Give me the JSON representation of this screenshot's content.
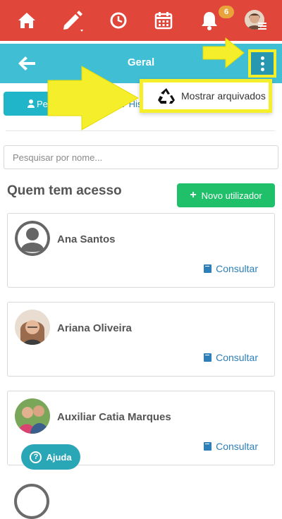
{
  "topbar": {
    "notification_count": "6",
    "icons": [
      "home-icon",
      "pencil-icon",
      "clock-icon",
      "calendar-icon",
      "bell-icon"
    ],
    "color": "#e0463a"
  },
  "subbar": {
    "title": "Geral",
    "color": "#40bfd4"
  },
  "tabs": {
    "left_label": "Pe",
    "right_label": "His"
  },
  "dropdown": {
    "item_label": "Mostrar arquivados"
  },
  "search": {
    "placeholder": "Pesquisar por nome..."
  },
  "access": {
    "title": "Quem tem acesso",
    "new_user_label": "Novo utilizador"
  },
  "users": [
    {
      "name": "Ana Santos",
      "action": "Consultar"
    },
    {
      "name": "Ariana Oliveira",
      "action": "Consultar"
    },
    {
      "name": "Auxiliar Catia Marques",
      "action": "Consultar"
    }
  ],
  "help": {
    "label": "Ajuda"
  },
  "colors": {
    "highlight": "#f4ef2a",
    "accent_green": "#20c06a",
    "link_blue": "#2c7fb8"
  }
}
